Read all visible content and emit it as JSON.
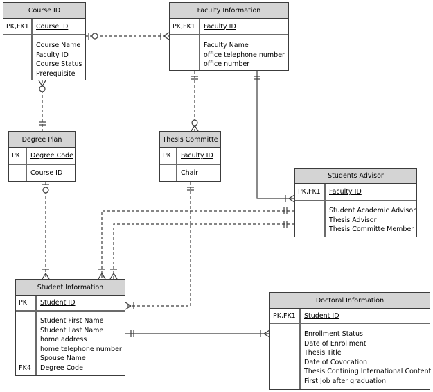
{
  "diagram": {
    "type": "entity-relationship",
    "entities": {
      "course": {
        "title": "Course ID",
        "key_label": "PK,FK1",
        "primary_key": "Course ID",
        "attributes": [
          "Course Name",
          "Faculty ID",
          "Course Status",
          "Prerequisite"
        ],
        "attribute_keys": [
          "",
          "",
          "",
          ""
        ]
      },
      "faculty": {
        "title": "Faculty Information",
        "key_label": "PK,FK1",
        "primary_key": "Faculty ID",
        "attributes": [
          "Faculty Name",
          "office telephone number",
          "office number"
        ],
        "attribute_keys": [
          "",
          "",
          ""
        ]
      },
      "degree_plan": {
        "title": "Degree Plan",
        "key_label": "PK",
        "primary_key": "Degree Code",
        "attributes": [
          "Course ID"
        ],
        "attribute_keys": [
          ""
        ]
      },
      "thesis_committee": {
        "title": "Thesis Committe",
        "key_label": "PK",
        "primary_key": "Faculty ID",
        "attributes": [
          "Chair"
        ],
        "attribute_keys": [
          ""
        ]
      },
      "students_advisor": {
        "title": "Students Advisor",
        "key_label": "PK,FK1",
        "primary_key": "Faculty ID",
        "attributes": [
          "Student Academic Advisor",
          "Thesis Advisor",
          "Thesis Committe Member"
        ],
        "attribute_keys": [
          "",
          "",
          ""
        ]
      },
      "student": {
        "title": "Student Information",
        "key_label": "PK",
        "primary_key": "Student ID",
        "attributes": [
          "Student First Name",
          "Student Last Name",
          "home address",
          "home telephone number",
          "Spouse Name",
          "Degree Code"
        ],
        "attribute_keys": [
          "",
          "",
          "",
          "",
          "",
          "FK4"
        ]
      },
      "doctoral": {
        "title": "Doctoral Information",
        "key_label": "PK,FK1",
        "primary_key": "Student ID",
        "attributes": [
          "Enrollment Status",
          "Date of Enrollment",
          "Thesis Title",
          "Date of Covocation",
          "Thesis Contining International Content",
          "First Job after graduation"
        ],
        "attribute_keys": [
          "",
          "",
          "",
          "",
          "",
          ""
        ]
      }
    },
    "relationships": [
      {
        "from": "Course ID",
        "to": "Faculty Information",
        "from_end": "zero-or-one",
        "to_end": "one-or-many",
        "style": "dashed"
      },
      {
        "from": "Course ID",
        "to": "Degree Plan",
        "from_end": "zero-or-many",
        "to_end": "one-and-only-one",
        "style": "dashed"
      },
      {
        "from": "Faculty Information",
        "to": "Thesis Committe",
        "from_end": "one-and-only-one",
        "to_end": "zero-or-many",
        "style": "dashed"
      },
      {
        "from": "Faculty Information",
        "to": "Students Advisor",
        "from_end": "one-and-only-one",
        "to_end": "one-or-many",
        "style": "solid"
      },
      {
        "from": "Degree Plan",
        "to": "Student Information",
        "from_end": "zero-or-one",
        "to_end": "one-or-many",
        "style": "dashed"
      },
      {
        "from": "Thesis Committe",
        "to": "Student Information",
        "from_end": "one-and-only-one",
        "to_end": "one-or-many",
        "style": "dashed"
      },
      {
        "from": "Students Advisor",
        "to": "Student Information",
        "from_end": "one-and-only-one",
        "to_end": "one-or-many",
        "style": "dashed"
      },
      {
        "from": "Students Advisor",
        "to": "Student Information",
        "from_end": "one-and-only-one",
        "to_end": "one-or-many",
        "style": "dashed"
      },
      {
        "from": "Student Information",
        "to": "Doctoral Information",
        "from_end": "one-and-only-one",
        "to_end": "one-or-many",
        "style": "solid"
      }
    ]
  }
}
